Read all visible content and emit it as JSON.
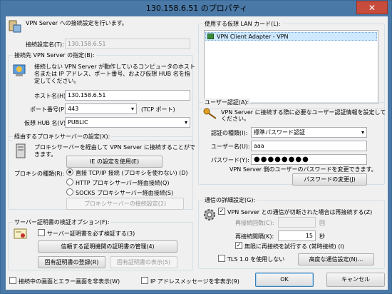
{
  "window": {
    "title": "130.158.6.51 のプロパティ",
    "close_glyph": "✕"
  },
  "header": {
    "text": "VPN Server への接続設定を行います。"
  },
  "connection": {
    "label": "接続設定名(T):",
    "value": "130.158.6.51"
  },
  "dest": {
    "legend": "接続先 VPN Server の指定(B):",
    "desc1": "接続しない VPN Server が動作しているコンピュータのホスト",
    "desc2": "名または IP アドレス、ポート番号、および仮想 HUB 名を指",
    "desc3": "定してください。",
    "host_label": "ホスト名(H):",
    "host_value": "130.158.6.51",
    "port_label": "ポート番号(P):",
    "port_value": "443",
    "port_suffix": "(TCP ポート)",
    "hub_label": "仮想 HUB 名(V):",
    "hub_value": "PUBLIC"
  },
  "proxy": {
    "legend": "経由するプロキシサーバーの設定(X):",
    "desc1": "プロキシサーバーを経由して VPN Server に接続することがで",
    "desc2": "きます。",
    "ie_button": "IE の設定を使用(E)",
    "type_label": "プロキシの種類(R):",
    "opt_direct": "直接 TCP/IP 接続 (プロキシを使わない) (D)",
    "opt_http": "HTTP プロキシサーバー経由接続(Q)",
    "opt_socks": "SOCKS プロキシサーバー経由接続(S)",
    "settings_button": "プロキシサーバーの接続設定(2)"
  },
  "cert": {
    "legend": "サーバー証明書の検証オプション(F):",
    "always_verify": "サーバー証明書を必ず検証する(3)",
    "manage_button": "信頼する証明機関の証明書の管理(4)",
    "register_button": "固有証明書の登録(R)",
    "show_button": "固有証明書の表示(5)"
  },
  "bottom": {
    "hide_status": "接続中の画面とエラー画面を非表示(W)",
    "hide_ip": "IP アドレスメッセージを非表示(9)",
    "ok": "OK",
    "cancel": "キャンセル"
  },
  "lan": {
    "legend": "使用する仮想 LAN カード(L):",
    "items": [
      "VPN Client Adapter - VPN"
    ]
  },
  "auth": {
    "legend": "ユーザー認証(A):",
    "desc1": "VPN Server に接続する際に必要なユーザー認証情報を設定して",
    "desc2": "ください。",
    "type_label": "認証の種類(I):",
    "type_value": "標準パスワード認証",
    "user_label": "ユーザー名(U):",
    "user_value": "aaa",
    "pass_label": "パスワード(Y):",
    "pass_value": "●●●●●●●●",
    "note": "VPN Server 側のユーザーのパスワードを変更できます。",
    "change_button": "パスワードの変更(J)"
  },
  "advanced": {
    "legend": "通信の詳細設定(G):",
    "reconnect": "VPN Server との通信が切断された場合は再接続する(Z)",
    "retry_count_label": "再接続回数(C):",
    "retry_count_value": "",
    "retry_count_unit": "回",
    "interval_label": "再接続間隔(K):",
    "interval_value": "15",
    "interval_unit": "秒",
    "infinite": "無限に再接続を試行する (常時接続) (I)",
    "tls": "TLS 1.0 を使用しない",
    "adv_button": "高度な通信設定(N)..."
  },
  "colors": {
    "accent": "#3c7fb1",
    "titlebar": "#4a79a7",
    "close": "#c74c3c"
  }
}
